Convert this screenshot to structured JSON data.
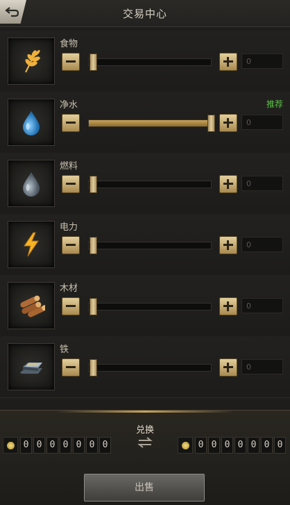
{
  "header": {
    "title": "交易中心"
  },
  "resources": [
    {
      "name": "食物",
      "icon": "wheat-icon",
      "quantity": "0",
      "slider_fraction": 0.0,
      "recommend": ""
    },
    {
      "name": "净水",
      "icon": "water-drop-icon",
      "quantity": "0",
      "slider_fraction": 1.0,
      "recommend": "推荐"
    },
    {
      "name": "燃料",
      "icon": "oil-drop-icon",
      "quantity": "0",
      "slider_fraction": 0.0,
      "recommend": ""
    },
    {
      "name": "电力",
      "icon": "lightning-icon",
      "quantity": "0",
      "slider_fraction": 0.0,
      "recommend": ""
    },
    {
      "name": "木材",
      "icon": "wood-logs-icon",
      "quantity": "0",
      "slider_fraction": 0.0,
      "recommend": ""
    },
    {
      "name": "铁",
      "icon": "iron-ingot-icon",
      "quantity": "0",
      "slider_fraction": 0.0,
      "recommend": ""
    }
  ],
  "exchange": {
    "title": "兑换",
    "left_digits": [
      "0",
      "0",
      "0",
      "0",
      "0",
      "0",
      "0"
    ],
    "right_digits": [
      "0",
      "0",
      "0",
      "0",
      "0",
      "0",
      "0"
    ]
  },
  "sell_button": {
    "label": "出售"
  },
  "colors": {
    "accent_gold": "#c9a458",
    "recommend_green": "#5cc04a"
  }
}
